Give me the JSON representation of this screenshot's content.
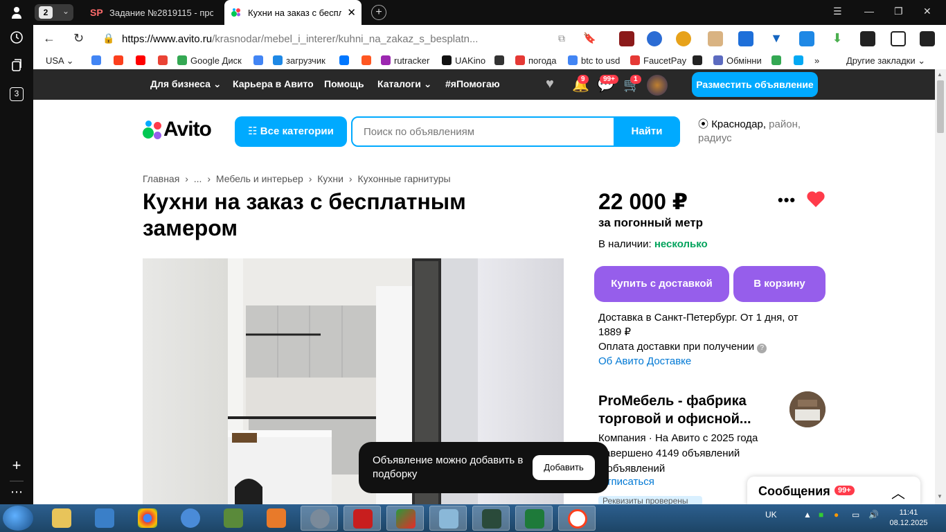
{
  "browser": {
    "tab_count": "2",
    "tabs": [
      {
        "title": "Задание №2819115 - про",
        "favicon": "SP"
      },
      {
        "title": "Кухни на заказ с беспла",
        "close": "✕"
      }
    ],
    "url_domain": "https://www.avito.ru",
    "url_path": "/krasnodar/mebel_i_interer/kuhni_na_zakaz_s_besplatn...",
    "rail_badge": "3",
    "bookmarks": [
      {
        "label": "USA",
        "color": "#ffffff"
      },
      {
        "label": "",
        "color": "#4285f4"
      },
      {
        "label": "",
        "color": "#fc3f1d"
      },
      {
        "label": "",
        "color": "#ff0000"
      },
      {
        "label": "",
        "color": "#ea4335"
      },
      {
        "label": "Google Диск",
        "color": "#34a853"
      },
      {
        "label": "",
        "color": "#4285f4"
      },
      {
        "label": "загрузчик",
        "color": "#1e88e5"
      },
      {
        "label": "",
        "color": "#0077ff"
      },
      {
        "label": "",
        "color": "#ff5722"
      },
      {
        "label": "rutracker",
        "color": "#9c27b0"
      },
      {
        "label": "UAKino",
        "color": "#111111"
      },
      {
        "label": "",
        "color": "#333333"
      },
      {
        "label": "погода",
        "color": "#e53935"
      },
      {
        "label": "btc to usd",
        "color": "#4285f4"
      },
      {
        "label": "FaucetPay",
        "color": "#e53935"
      },
      {
        "label": "",
        "color": "#222222"
      },
      {
        "label": "Обмінни",
        "color": "#5c6bc0"
      },
      {
        "label": "",
        "color": "#34a853"
      },
      {
        "label": "",
        "color": "#03a9f4"
      }
    ],
    "bookmarks_more": "»",
    "other_bookmarks": "Другие закладки"
  },
  "avito_nav": {
    "links": [
      "Для бизнеса ⌄",
      "Карьера в Авито",
      "Помощь",
      "Каталоги ⌄",
      "#яПомогаю"
    ],
    "badges": {
      "notifications": "9",
      "messages": "99+",
      "cart": "1"
    },
    "post_button": "Разместить объявление"
  },
  "header": {
    "logo": "Avito",
    "categories_button": "Все категории",
    "search_placeholder": "Поиск по объявлениям",
    "search_button": "Найти",
    "location_city": "Краснодар,",
    "location_rest": " район, радиус"
  },
  "breadcrumbs": [
    "Главная",
    "›",
    "...",
    "›",
    "Мебель и интерьер",
    "›",
    "Кухни",
    "›",
    "Кухонные гарнитуры"
  ],
  "listing": {
    "title": "Кухни на заказ с бесплатным замером",
    "price": "22 000 ₽",
    "price_unit": "за погонный метр",
    "availability_label": "В наличии:",
    "availability_value": "несколько",
    "buy_button": "Купить с доставкой",
    "cart_button": "В корзину",
    "delivery_text": "Доставка в Санкт-Петербург. От 1 дня, от 1889 ₽",
    "payment_text": "Оплата доставки при получении",
    "delivery_link": "Об Авито Доставке"
  },
  "seller": {
    "name": "ProМебель - фабрика торговой и офисной...",
    "info_1": "Компания · На Авито с 2025 года",
    "info_2": "Завершено 4149 объявлений",
    "info_3": "3 объявлений",
    "subscribe": "Отписаться",
    "verified": "Реквизиты проверены"
  },
  "toast": {
    "text": "Объявление можно добавить в подборку",
    "button": "Добавить"
  },
  "messages_panel": {
    "title": "Сообщения",
    "badge": "99+"
  },
  "taskbar": {
    "lang": "UK",
    "time": "11:41",
    "date": "08.12.2025"
  },
  "colors": {
    "accent": "#00aaff",
    "purple": "#965eeb",
    "green": "#02a35c",
    "heart": "#ff3b4a"
  }
}
